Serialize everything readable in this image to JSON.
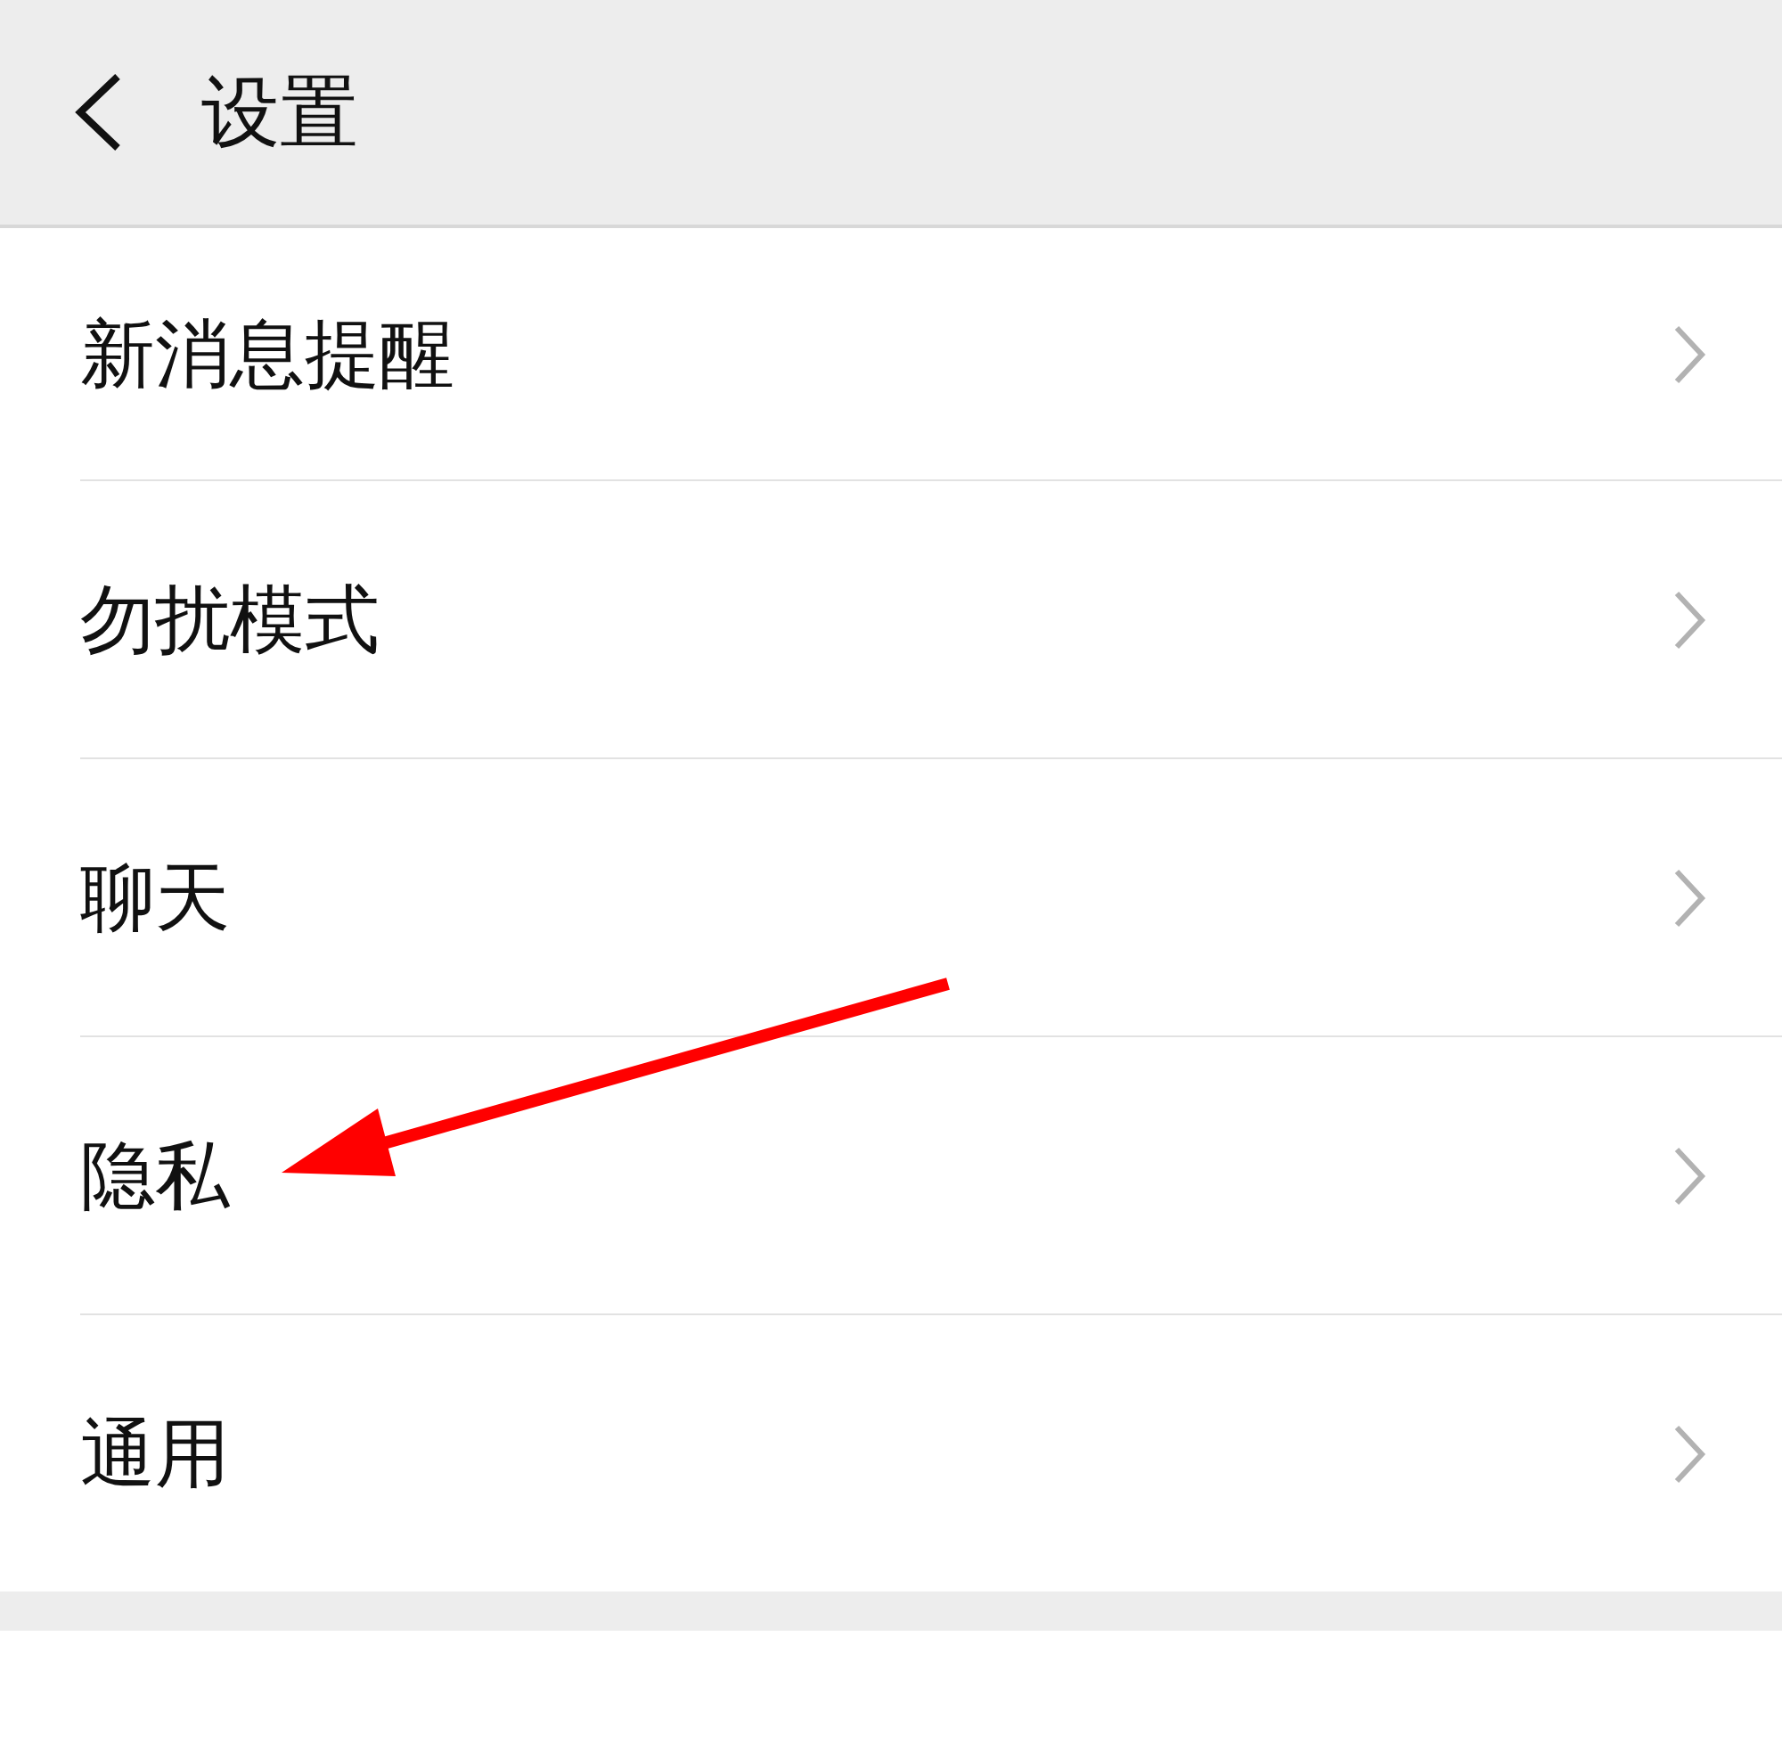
{
  "header": {
    "title": "设置"
  },
  "groups": [
    {
      "items": [
        {
          "label": "新消息提醒"
        },
        {
          "label": "勿扰模式"
        },
        {
          "label": "聊天"
        },
        {
          "label": "隐私"
        },
        {
          "label": "通用"
        }
      ]
    }
  ]
}
